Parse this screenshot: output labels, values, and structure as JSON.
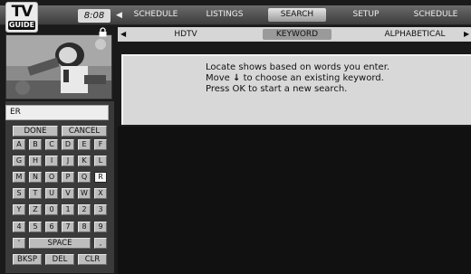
{
  "app": {
    "logo_top": "TV",
    "logo_bottom": "GUIDE",
    "clock": "8:08"
  },
  "menu": {
    "items": [
      {
        "label": "SCHEDULE",
        "active": false
      },
      {
        "label": "LISTINGS",
        "active": false
      },
      {
        "label": "SEARCH",
        "active": true
      },
      {
        "label": "SETUP",
        "active": false
      },
      {
        "label": "SCHEDULE",
        "active": false
      }
    ]
  },
  "submenu": {
    "items": [
      {
        "label": "HDTV",
        "active": false
      },
      {
        "label": "KEYWORD",
        "active": true
      },
      {
        "label": "ALPHABETICAL",
        "active": false
      }
    ]
  },
  "info": {
    "line1": "Locate shows based on words you enter.",
    "line2_prefix": "Move",
    "line2_arrow": "↓",
    "line2_suffix": "to choose an existing keyword.",
    "line3": "Press OK to start a new search."
  },
  "search": {
    "value": "ER"
  },
  "keyboard": {
    "done": "DONE",
    "cancel": "CANCEL",
    "rows": [
      [
        "A",
        "B",
        "C",
        "D",
        "E",
        "F"
      ],
      [
        "G",
        "H",
        "I",
        "J",
        "K",
        "L"
      ],
      [
        "M",
        "N",
        "O",
        "P",
        "Q",
        "R"
      ],
      [
        "S",
        "T",
        "U",
        "V",
        "W",
        "X"
      ],
      [
        "Y",
        "Z",
        "0",
        "1",
        "2",
        "3"
      ],
      [
        "4",
        "5",
        "6",
        "7",
        "8",
        "9"
      ]
    ],
    "selected": "R",
    "apostrophe": "'",
    "space": "SPACE",
    "comma": ",",
    "bksp": "BKSP",
    "del": "DEL",
    "clr": "CLR"
  },
  "icons": {
    "lock": "lock-icon",
    "left_arrow": "left-arrow-icon",
    "right_arrow": "right-arrow-icon",
    "down_arrow": "down-arrow-icon"
  },
  "colors": {
    "topbar": "#4a4a4a",
    "subbar": "#d6d6d6",
    "info_panel": "#d8d8d8",
    "key": "#bdbdbd",
    "key_selected": "#f4f4f4"
  }
}
